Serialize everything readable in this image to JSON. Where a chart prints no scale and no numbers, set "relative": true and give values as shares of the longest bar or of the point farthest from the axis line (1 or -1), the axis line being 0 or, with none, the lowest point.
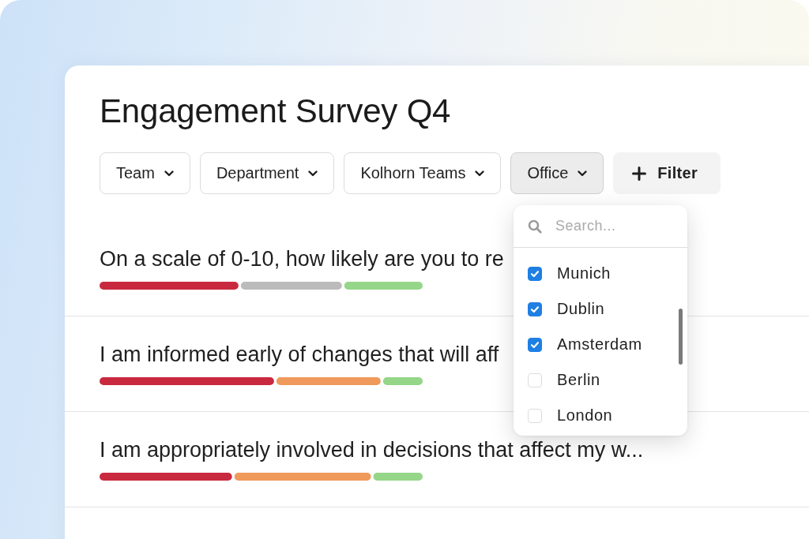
{
  "title": "Engagement Survey Q4",
  "filters": [
    {
      "label": "Team",
      "expanded": false
    },
    {
      "label": "Department",
      "expanded": false
    },
    {
      "label": "Kolhorn Teams",
      "expanded": false
    },
    {
      "label": "Office",
      "expanded": true
    }
  ],
  "add_filter": {
    "label": "Filter"
  },
  "questions": [
    {
      "text": "On a scale of 0-10, how likely are you to re",
      "chart_data": {
        "type": "bar",
        "orientation": "horizontal",
        "stacked": true,
        "relative": true,
        "categories": [
          null
        ],
        "series": [
          {
            "color": "#c9293f",
            "values": [
              0.43
            ]
          },
          {
            "color": "#bbbbbb",
            "values": [
              0.32
            ]
          },
          {
            "color": "#95d689",
            "values": [
              0.25
            ]
          }
        ]
      }
    },
    {
      "text": "I am informed early of changes that will aff",
      "chart_data": {
        "type": "bar",
        "orientation": "horizontal",
        "stacked": true,
        "relative": true,
        "categories": [
          null
        ],
        "series": [
          {
            "color": "#c9293f",
            "values": [
              0.54
            ]
          },
          {
            "color": "#ef9a5b",
            "values": [
              0.33
            ]
          },
          {
            "color": "#95d689",
            "values": [
              0.13
            ]
          }
        ]
      }
    },
    {
      "text": "I am appropriately involved in decisions that affect my w...",
      "chart_data": {
        "type": "bar",
        "orientation": "horizontal",
        "stacked": true,
        "relative": true,
        "categories": [
          null
        ],
        "series": [
          {
            "color": "#c9293f",
            "values": [
              0.41
            ]
          },
          {
            "color": "#ef9a5b",
            "values": [
              0.43
            ]
          },
          {
            "color": "#95d689",
            "values": [
              0.16
            ]
          }
        ]
      }
    }
  ],
  "office_dropdown": {
    "search": {
      "placeholder": "Search..."
    },
    "options": [
      {
        "label": "Munich",
        "checked": true
      },
      {
        "label": "Dublin",
        "checked": true
      },
      {
        "label": "Amsterdam",
        "checked": true
      },
      {
        "label": "Berlin",
        "checked": false
      },
      {
        "label": "London",
        "checked": false
      }
    ]
  }
}
